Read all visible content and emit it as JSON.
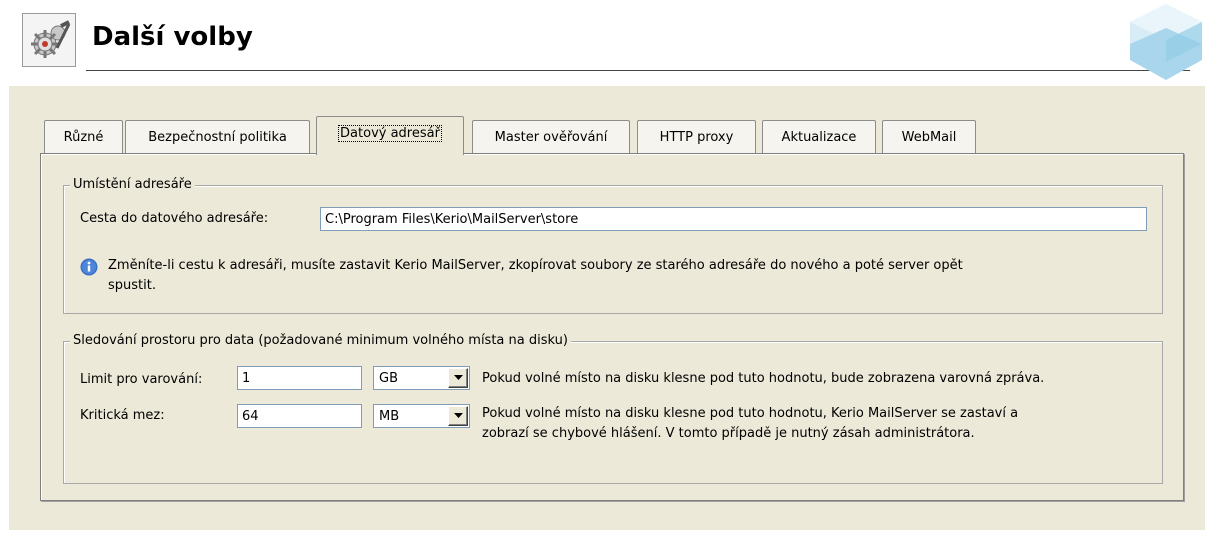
{
  "header": {
    "title": "Další volby",
    "icon": "gears-tools-icon",
    "logo": "kerio-cube-logo"
  },
  "tabs": [
    {
      "label": "Různé",
      "active": false
    },
    {
      "label": "Bezpečnostní politika",
      "active": false
    },
    {
      "label": "Datový adresář",
      "active": true
    },
    {
      "label": "Master ověřování",
      "active": false
    },
    {
      "label": "HTTP proxy",
      "active": false
    },
    {
      "label": "Aktualizace",
      "active": false
    },
    {
      "label": "WebMail",
      "active": false
    }
  ],
  "location_group": {
    "title": "Umístění adresáře",
    "path_label": "Cesta do datového adresáře:",
    "path_value": "C:\\Program Files\\Kerio\\MailServer\\store",
    "info_line1": "Změníte-li cestu k adresáři, musíte zastavit Kerio MailServer, zkopírovat soubory ze starého adresáře do nového a poté server opět",
    "info_line2": "spustit."
  },
  "space_group": {
    "title": "Sledování prostoru pro data (požadované minimum volného místa na disku)",
    "warning": {
      "label": "Limit pro varování:",
      "value": "1",
      "unit": "GB",
      "description": "Pokud volné místo na disku klesne pod tuto hodnotu, bude zobrazena varovná zpráva."
    },
    "critical": {
      "label": "Kritická mez:",
      "value": "64",
      "unit": "MB",
      "description_line1": "Pokud volné místo na disku klesne pod tuto hodnotu, Kerio MailServer se zastaví a",
      "description_line2": "zobrazí se chybové hlášení. V tomto případě je nutný zásah administrátora."
    }
  },
  "colors": {
    "panel_bg": "#ece9d8",
    "info_icon": "#3a6fc4"
  }
}
